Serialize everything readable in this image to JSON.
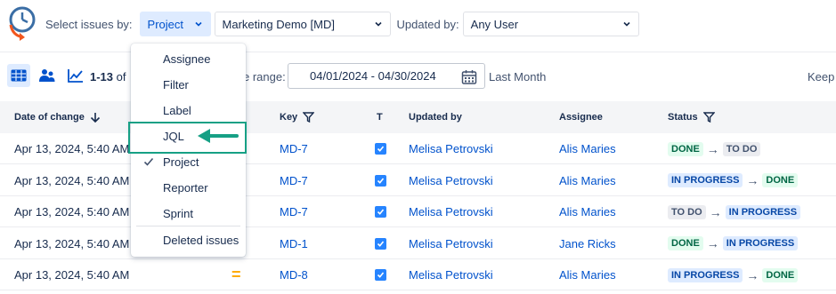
{
  "colors": {
    "accent": "#0052cc",
    "highlight": "#16a085",
    "logo_blue": "#3b6ea5",
    "logo_orange": "#f2561d"
  },
  "filters": {
    "select_label": "Select issues by:",
    "select_value": "Project",
    "project_value": "Marketing Demo [MD]",
    "updated_label": "Updated by:",
    "updated_value": "Any User"
  },
  "toolbar": {
    "count_bold": "1-13",
    "count_rest": " of",
    "range_label": "e range:",
    "date_range": "04/01/2024 - 04/30/2024",
    "preset": "Last Month",
    "keep": "Keep"
  },
  "table": {
    "headers": {
      "date": "Date of change",
      "key": "Key",
      "type": "T",
      "updated_by": "Updated by",
      "assignee": "Assignee",
      "status": "Status"
    },
    "rows": [
      {
        "date": "Apr 13, 2024, 5:40 AM",
        "key": "MD-7",
        "updated_by": "Melisa Petrovski",
        "assignee": "Alis Maries",
        "from": "DONE",
        "to": "TO DO",
        "from_style": "done",
        "to_style": "todo",
        "priority": ""
      },
      {
        "date": "Apr 13, 2024, 5:40 AM",
        "key": "MD-7",
        "updated_by": "Melisa Petrovski",
        "assignee": "Alis Maries",
        "from": "IN PROGRESS",
        "to": "DONE",
        "from_style": "prog",
        "to_style": "done",
        "priority": ""
      },
      {
        "date": "Apr 13, 2024, 5:40 AM",
        "key": "MD-7",
        "updated_by": "Melisa Petrovski",
        "assignee": "Alis Maries",
        "from": "TO DO",
        "to": "IN PROGRESS",
        "from_style": "todo",
        "to_style": "prog",
        "priority": ""
      },
      {
        "date": "Apr 13, 2024, 5:40 AM",
        "key": "MD-1",
        "updated_by": "Melisa Petrovski",
        "assignee": "Jane Ricks",
        "from": "DONE",
        "to": "IN PROGRESS",
        "from_style": "done",
        "to_style": "prog",
        "priority": ""
      },
      {
        "date": "Apr 13, 2024, 5:40 AM",
        "key": "MD-8",
        "updated_by": "Melisa Petrovski",
        "assignee": "Alis Maries",
        "from": "IN PROGRESS",
        "to": "DONE",
        "from_style": "prog",
        "to_style": "done",
        "priority": "="
      }
    ]
  },
  "menu": {
    "items": [
      "Assignee",
      "Filter",
      "Label",
      "JQL",
      "Project",
      "Reporter",
      "Sprint",
      "Deleted issues"
    ],
    "selected": "Project",
    "highlighted": "JQL"
  }
}
